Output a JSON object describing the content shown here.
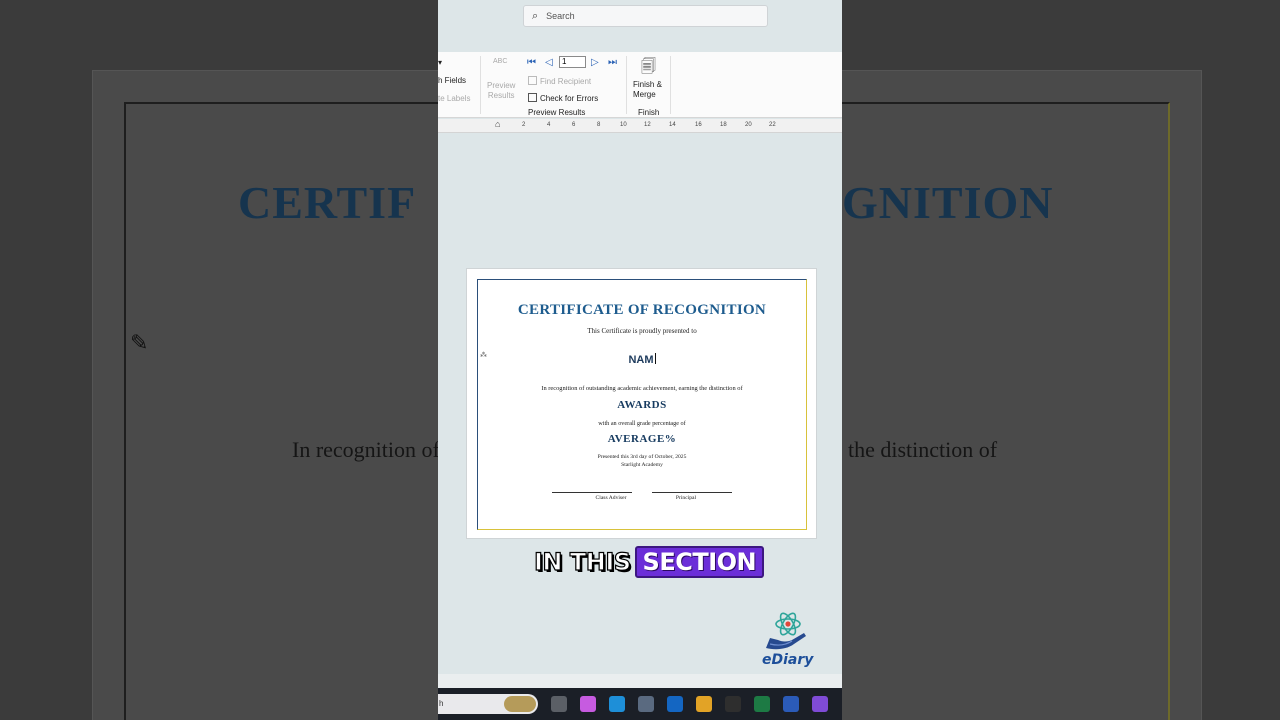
{
  "background": {
    "title_left": "CERTIF",
    "title_right": "GNITION",
    "line_left": "In recognition of",
    "line_right": "the distinction of"
  },
  "search": {
    "placeholder": "Search"
  },
  "ribbon": {
    "fields": "h Fields",
    "labels": "te Labels",
    "abc": "ABC",
    "preview_results_btn": "Preview\nResults",
    "record": "1",
    "find_recipient": "Find Recipient",
    "check_errors": "Check for Errors",
    "group_preview": "Preview Results",
    "finish_merge": "Finish &\nMerge",
    "group_finish": "Finish"
  },
  "ruler": {
    "ticks": [
      "2",
      "4",
      "6",
      "8",
      "10",
      "12",
      "14",
      "16",
      "18",
      "20",
      "22"
    ]
  },
  "certificate": {
    "title": "CERTIFICATE OF RECOGNITION",
    "subtitle": "This Certificate is proudly presented to",
    "name": "NAM",
    "recognition": "In recognition of outstanding academic achievement, earning the distinction of",
    "awards": "AWARDS",
    "grade_line": "with an overall grade percentage of",
    "average": "AVERAGE%",
    "presented": "Presented this 3rd day of October, 2025",
    "school": "Starlight Academy",
    "sig1": "Class Adviser",
    "sig2": "Principal"
  },
  "caption": {
    "word1": "IN THIS",
    "word2": "SECTION"
  },
  "logo": {
    "text": "eDiary"
  },
  "taskbar": {
    "search_text": "h",
    "icons": [
      {
        "name": "file-explorer-icon",
        "color": "#5b5f66"
      },
      {
        "name": "copilot-icon",
        "color": "#c65be0"
      },
      {
        "name": "edge-icon",
        "color": "#1e8fd8"
      },
      {
        "name": "store-icon",
        "color": "#5a6a80"
      },
      {
        "name": "outlook-icon",
        "color": "#1466c2"
      },
      {
        "name": "chrome-icon",
        "color": "#e2a326"
      },
      {
        "name": "obs-icon",
        "color": "#2e2e2e"
      },
      {
        "name": "excel-icon",
        "color": "#1d7a44"
      },
      {
        "name": "word-icon",
        "color": "#2b5bb8"
      },
      {
        "name": "clipchamp-icon",
        "color": "#7f4bd6"
      }
    ]
  }
}
